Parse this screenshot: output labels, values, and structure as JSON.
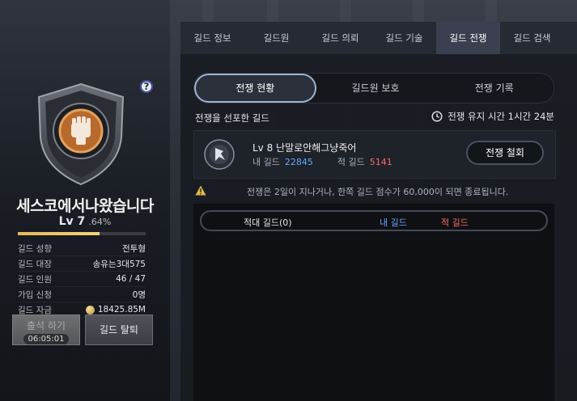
{
  "left": {
    "guild_name": "세스코에서나왔습니다",
    "level_text": "Lv 7",
    "exp_percent_text": ".64%",
    "exp_fraction": 0.64,
    "info": [
      {
        "key": "길드 성향",
        "value": "전투형"
      },
      {
        "key": "길드 대장",
        "value": "송유는3대575"
      },
      {
        "key": "길드 인원",
        "value": "46 / 47"
      },
      {
        "key": "가입 신청",
        "value": "0명"
      },
      {
        "key": "길드 자금",
        "value": "18425.85M"
      }
    ],
    "attend_label": "출석 하기",
    "attend_timer": "06:05:01",
    "leave_label": "길드 탈퇴",
    "help_label": "?"
  },
  "tabs": [
    "길드 정보",
    "길드원",
    "길드 의뢰",
    "길드 기술",
    "길드 전쟁",
    "길드 검색"
  ],
  "active_tab": "길드 전쟁",
  "subtabs": [
    "전쟁 현황",
    "길드원 보호",
    "전쟁 기록"
  ],
  "war": {
    "declared_label": "전쟁을 선포한 길드",
    "duration_text": "전쟁 유지 시간 1시간 24분",
    "enemy_title": "Lv 8 난말로안해그냥죽어",
    "my_guild_label": "내 길드",
    "my_guild_score": "22845",
    "enemy_guild_label": "적 길드",
    "enemy_guild_score": "5141",
    "cancel_label": "전쟁 철회",
    "notice": "전쟁은 2일이 지나거나, 한쪽 길드 점수가 60,000이 되면 종료됩니다."
  },
  "list_header": {
    "enemy": "적대 길드(0)",
    "mine": "내 길드",
    "theirs": "적 길드"
  },
  "colors": {
    "my_score": "#6aa8ff",
    "enemy_score": "#ff6b6b",
    "exp_bar": "#e7b95b"
  }
}
